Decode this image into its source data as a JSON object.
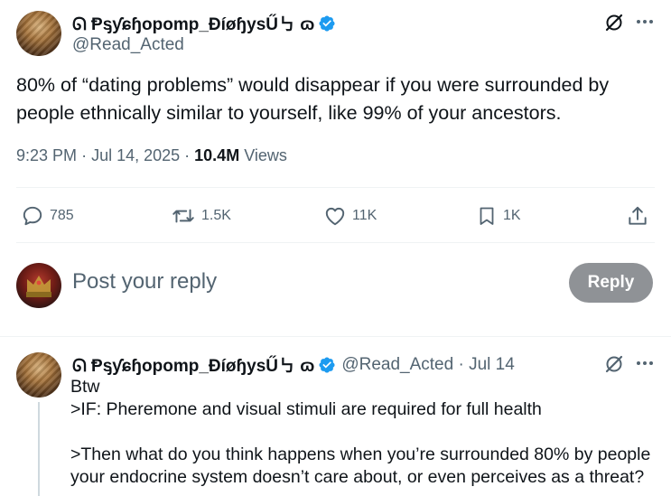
{
  "main_post": {
    "display_name": "ᘏ Ᵽᶊƴɕɧopomp_ĐíøɧysŰ㇉ ɷ",
    "handle": "@Read_Acted",
    "text": "80% of “dating problems” would disappear if you were surrounded by people ethnically similar to yourself, like 99% of your ancestors.",
    "time": "9:23 PM",
    "date": "Jul 14, 2025",
    "views_count": "10.4M",
    "views_label": "Views",
    "stats": {
      "replies": "785",
      "reposts": "1.5K",
      "likes": "11K",
      "bookmarks": "1K"
    }
  },
  "reply_box": {
    "placeholder": "Post your reply",
    "button_label": "Reply"
  },
  "reply_post": {
    "display_name": "ᘏ Ᵽᶊƴɕɧopomp_ĐíøɧysŰ㇉ ɷ",
    "handle": "@Read_Acted",
    "date": "Jul 14",
    "text": "Btw\n>IF: Pheremone and visual stimuli are required for full health\n\n>Then what do you think happens when you’re surrounded 80% by people\nyour endocrine system doesn’t care about, or even perceives as a threat?"
  },
  "colors": {
    "accent": "#1d9bf0",
    "secondary_text": "#536471",
    "reply_button_bg": "#8f9296"
  }
}
